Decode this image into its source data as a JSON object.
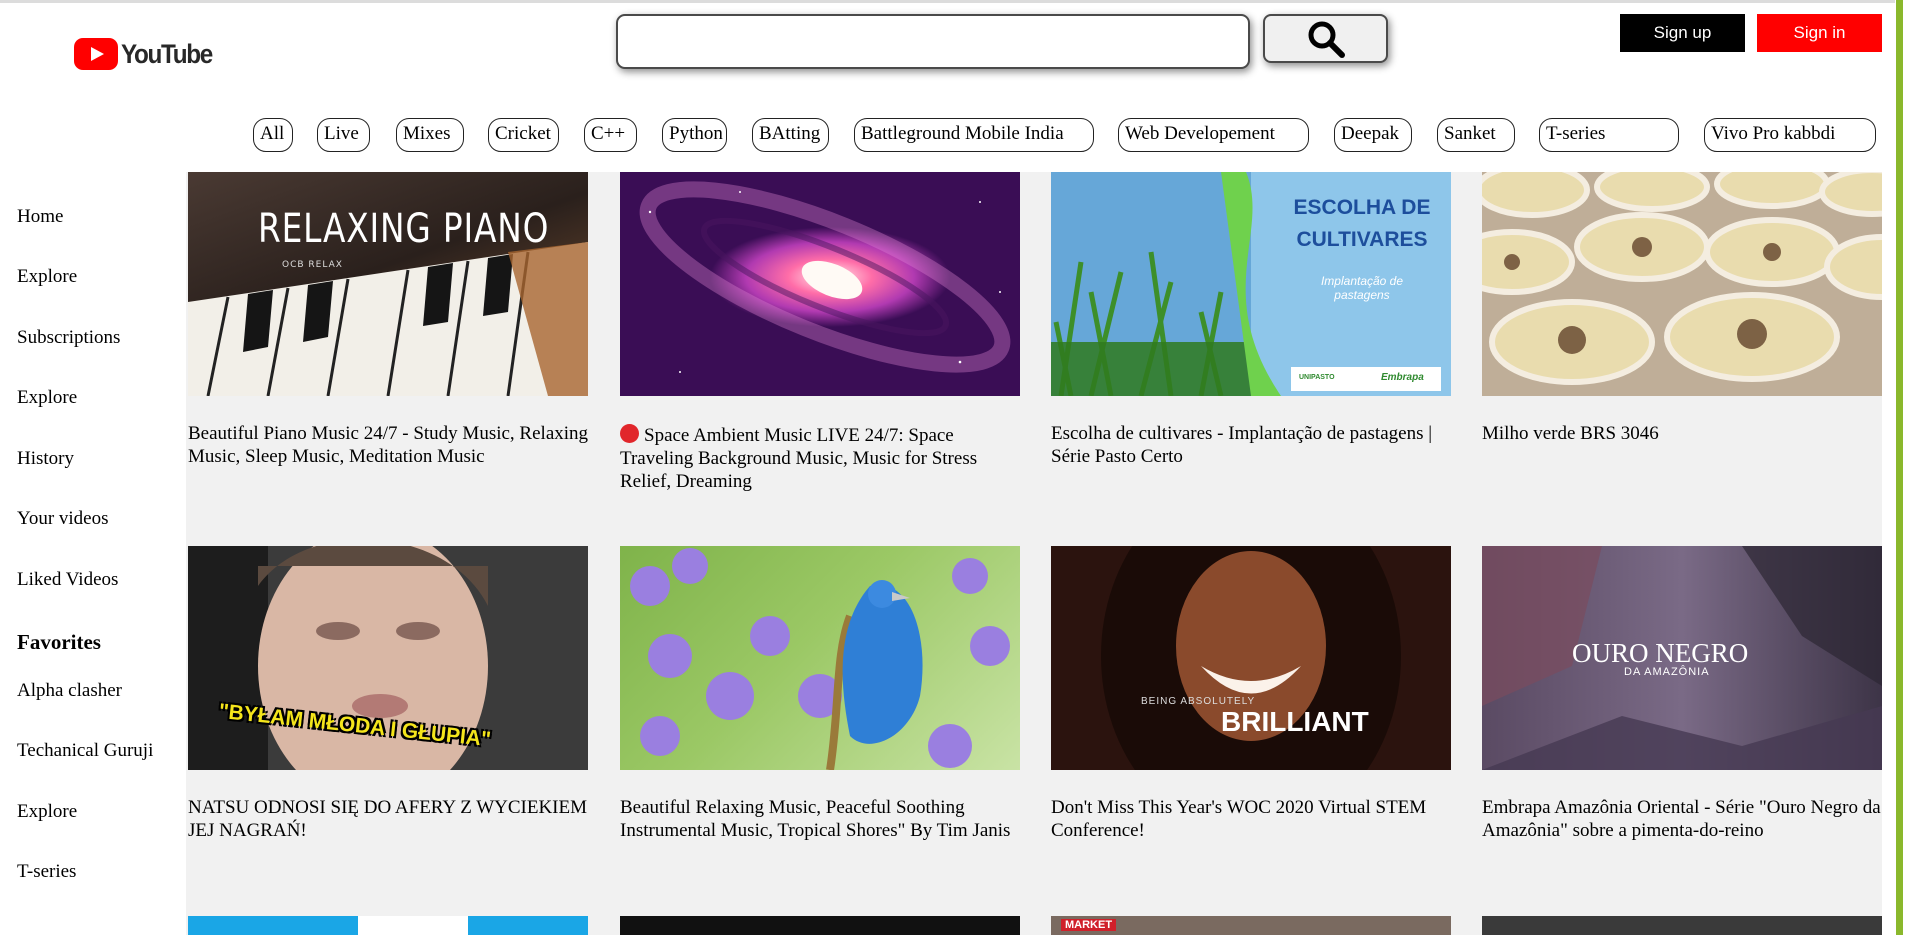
{
  "brand": {
    "logo_text": "YouTube",
    "accent": "#ff0000"
  },
  "search": {
    "value": "",
    "placeholder": "",
    "icon": "search-icon"
  },
  "auth": {
    "signup_label": "Sign up",
    "signin_label": "Sign in"
  },
  "chips": [
    "All",
    "Live",
    "Mixes",
    "Cricket",
    "C++",
    "Python",
    "BAtting",
    "Battleground Mobile India",
    "Web Developement",
    "Deepak",
    "Sanket",
    "T-series",
    "Vivo Pro kabbdi"
  ],
  "sidebar": {
    "items": [
      "Home",
      "Explore",
      "Subscriptions",
      "Explore",
      "History",
      "Your videos",
      "Liked Videos"
    ],
    "favorites_heading": "Favorites",
    "favorites": [
      "Alpha clasher",
      "Techanical Guruji",
      "Explore",
      "T-series"
    ]
  },
  "videos": [
    {
      "title": "Beautiful Piano Music 24/7 - Study Music, Relaxing Music, Sleep Music, Meditation Music",
      "thumb_text": "RELAXING PIANO",
      "thumb_sub": "OCB RELAX"
    },
    {
      "title": "Space Ambient Music LIVE 24/7: Space Traveling Background Music, Music for Stress Relief, Dreaming",
      "live_indicator": "🔴"
    },
    {
      "title": "Escolha de cultivares - Implantação de pastagens | Série Pasto Certo",
      "thumb_text": "ESCOLHA DE CULTIVARES",
      "thumb_sub": "Implantação de pastagens",
      "thumb_logos": [
        "UNIPASTO",
        "Embrapa"
      ]
    },
    {
      "title": "Milho verde BRS 3046"
    },
    {
      "title": "NATSU ODNOSI SIĘ DO AFERY Z WYCIEKIEM JEJ NAGRAŃ!",
      "thumb_text": "\"BYŁAM MŁODA I GŁUPIA\""
    },
    {
      "title": "Beautiful Relaxing Music, Peaceful Soothing Instrumental Music, Tropical Shores\" By Tim Janis"
    },
    {
      "title": "Don't Miss This Year's WOC 2020 Virtual STEM Conference!",
      "thumb_text": "BRILLIANT",
      "thumb_sub": "BEING ABSOLUTELY"
    },
    {
      "title": "Embrapa Amazônia Oriental - Série \"Ouro Negro da Amazônia\" sobre a pimenta-do-reino",
      "thumb_text": "OURO NEGRO",
      "thumb_sub": "DA AMAZÔNIA"
    }
  ],
  "row3_thumb_texts": [
    "MARKET"
  ]
}
